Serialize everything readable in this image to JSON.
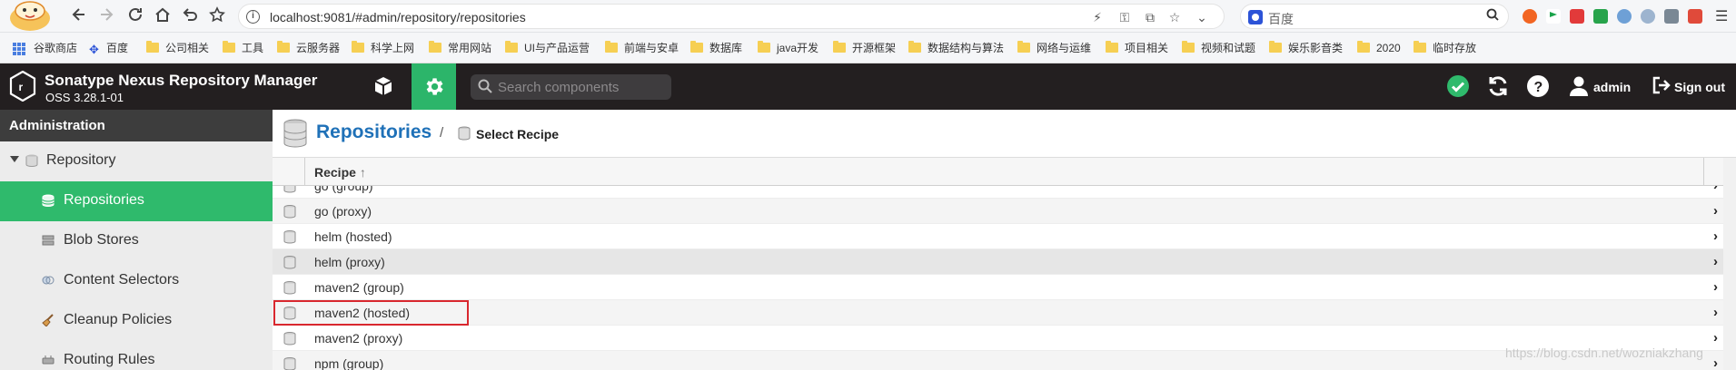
{
  "browser": {
    "url": "localhost:9081/#admin/repository/repositories",
    "search_placeholder": "百度",
    "bookmarks": [
      "谷歌商店",
      "百度",
      "公司相关",
      "工具",
      "云服务器",
      "科学上网",
      "常用网站",
      "UI与产品运营",
      "前端与安卓",
      "数据库",
      "java开发",
      "开源框架",
      "数据结构与算法",
      "网络与运维",
      "项目相关",
      "视频和试题",
      "娱乐影音类",
      "2020",
      "临时存放"
    ]
  },
  "header": {
    "app_title": "Sonatype Nexus Repository Manager",
    "version": "OSS 3.28.1-01",
    "search_placeholder": "Search components",
    "user": "admin",
    "sign_out": "Sign out"
  },
  "sidebar": {
    "title": "Administration",
    "group": "Repository",
    "items": [
      "Repositories",
      "Blob Stores",
      "Content Selectors",
      "Cleanup Policies",
      "Routing Rules"
    ],
    "selected": "Repositories"
  },
  "breadcrumb": {
    "title": "Repositories",
    "separator": "/",
    "current": "Select Recipe"
  },
  "grid": {
    "column": "Recipe",
    "sort_arrow": "↑",
    "rows": [
      "go (group)",
      "go (proxy)",
      "helm (hosted)",
      "helm (proxy)",
      "maven2 (group)",
      "maven2 (hosted)",
      "maven2 (proxy)",
      "npm (group)"
    ],
    "hovered_row": "helm (proxy)",
    "outlined_row": "maven2 (hosted)"
  },
  "watermark": "https://blog.csdn.net/wozniakzhang",
  "colors": {
    "nexus_green": "#2fba6c",
    "header_bg": "#231f20",
    "title_blue": "#1f71b8",
    "outline_red": "#d9272e"
  },
  "icons": [
    "back-icon",
    "forward-icon",
    "reload-icon",
    "home-icon",
    "undo-icon",
    "star-icon",
    "browse-cube-icon",
    "gear-icon",
    "search-icon",
    "healthy-check-icon",
    "refresh-icon",
    "help-icon",
    "user-icon",
    "sign-out-icon",
    "database-icon",
    "chevron-right-icon"
  ]
}
